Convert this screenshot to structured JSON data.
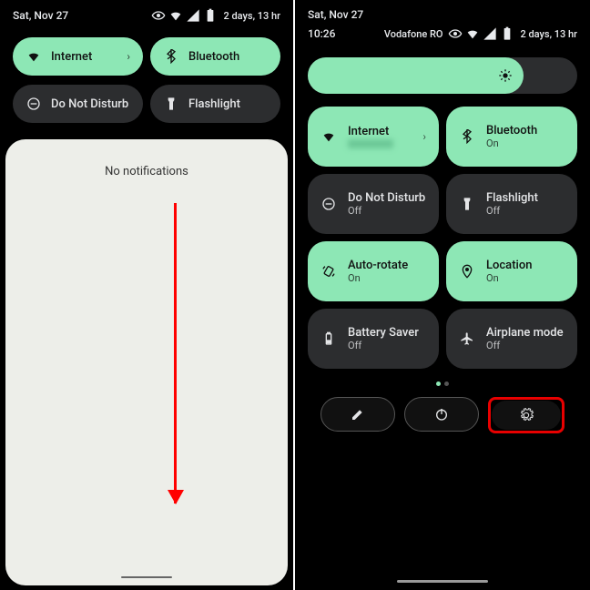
{
  "left": {
    "status_date": "Sat, Nov 27",
    "status_time_right": "2 days, 13 hr",
    "tiles": {
      "internet": "Internet",
      "bluetooth": "Bluetooth",
      "dnd": "Do Not Disturb",
      "flashlight": "Flashlight"
    },
    "notifications_empty": "No notifications"
  },
  "right": {
    "status_date": "Sat, Nov 27",
    "status_time": "10:26",
    "status_carrier": "Vodafone RO",
    "status_time_right": "2 days, 13 hr",
    "brightness_pct": 80,
    "tiles": [
      {
        "label": "Internet",
        "status": null,
        "active": true,
        "icon": "wifi",
        "chevron": true
      },
      {
        "label": "Bluetooth",
        "status": "On",
        "active": true,
        "icon": "bt"
      },
      {
        "label": "Do Not Disturb",
        "status": "Off",
        "active": false,
        "icon": "dnd"
      },
      {
        "label": "Flashlight",
        "status": "Off",
        "active": false,
        "icon": "flash"
      },
      {
        "label": "Auto-rotate",
        "status": "On",
        "active": true,
        "icon": "rotate"
      },
      {
        "label": "Location",
        "status": "On",
        "active": true,
        "icon": "location"
      },
      {
        "label": "Battery Saver",
        "status": "Off",
        "active": false,
        "icon": "battery"
      },
      {
        "label": "Airplane mode",
        "status": "Off",
        "active": false,
        "icon": "airplane"
      }
    ]
  }
}
